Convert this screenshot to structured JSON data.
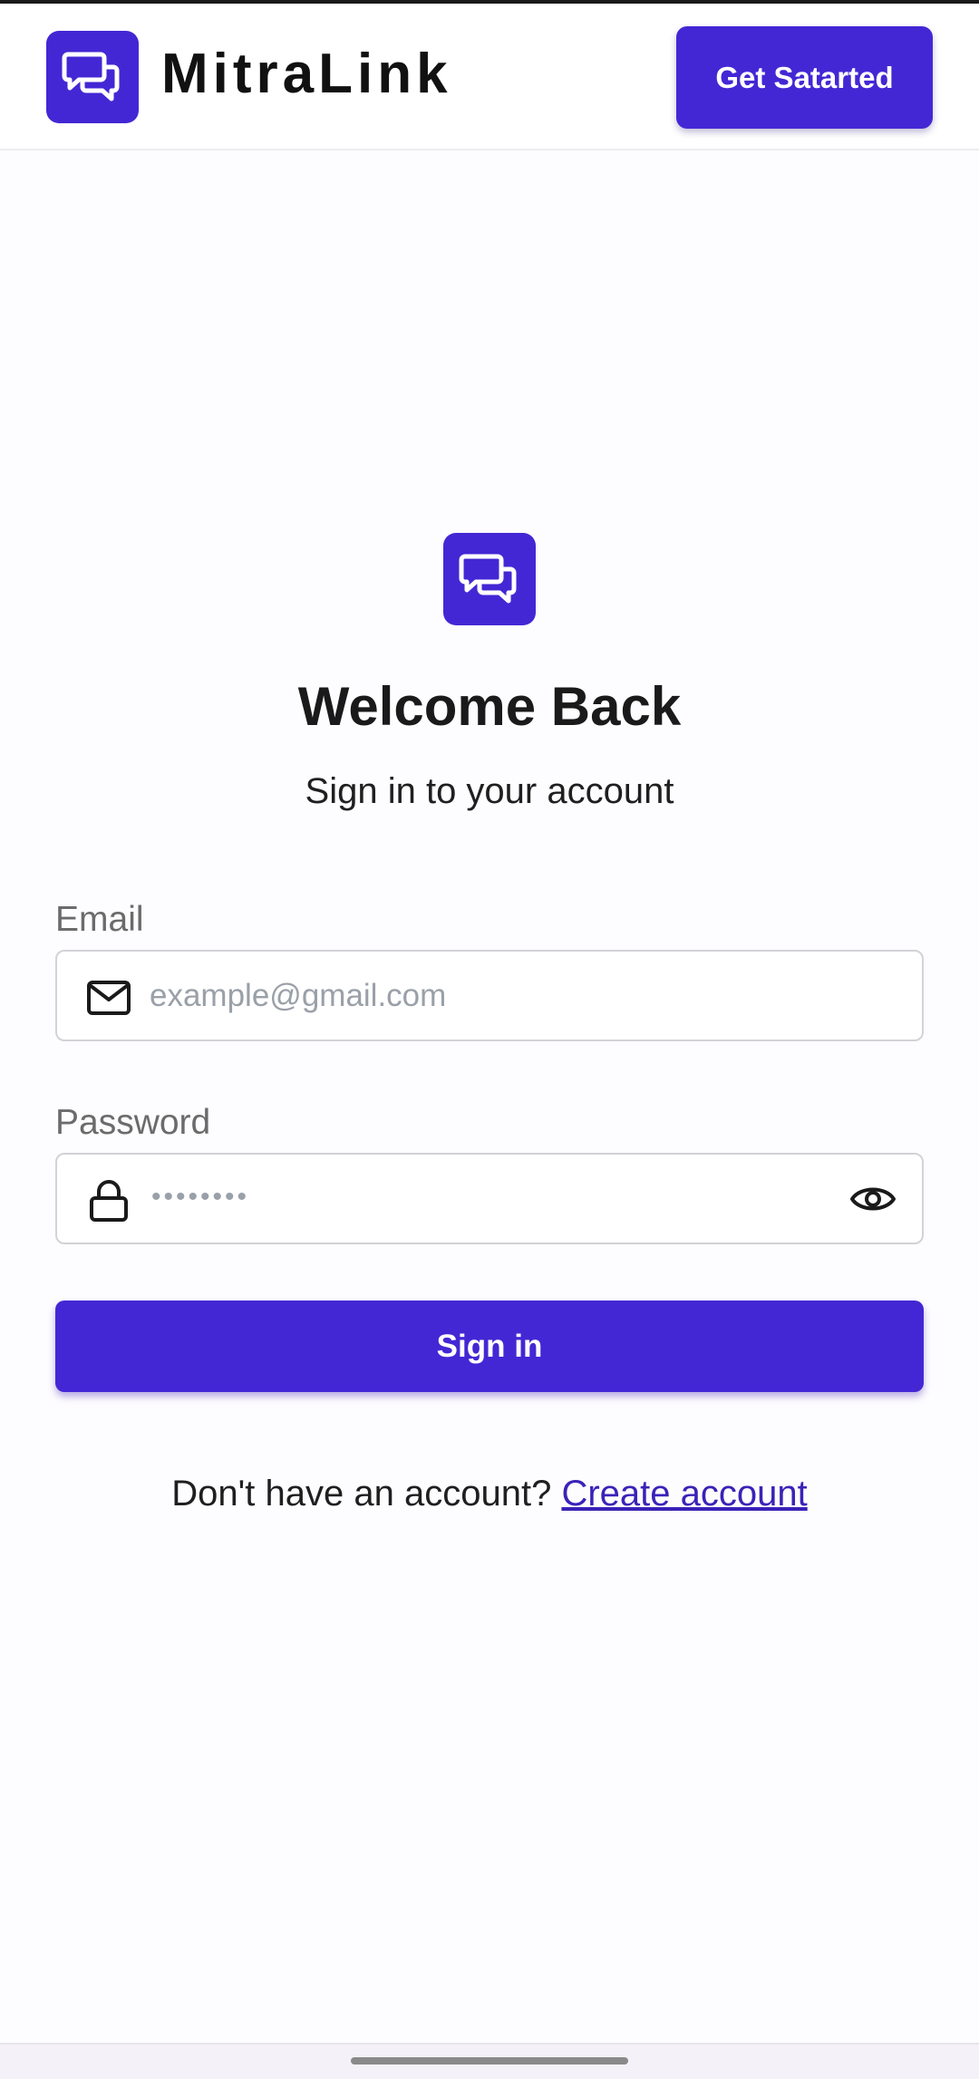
{
  "header": {
    "brand_name": "MitraLink",
    "cta_label": "Get Satarted",
    "logo_icon": "chat-bubbles-icon"
  },
  "hero": {
    "logo_icon": "chat-bubbles-icon",
    "title": "Welcome Back",
    "subtitle": "Sign in to your account"
  },
  "form": {
    "email": {
      "label": "Email",
      "placeholder": "example@gmail.com",
      "value": "",
      "icon": "mail-icon"
    },
    "password": {
      "label": "Password",
      "masked_value": "••••••••",
      "icon": "lock-icon",
      "toggle_icon": "eye-icon"
    },
    "submit_label": "Sign in"
  },
  "footer": {
    "prompt": "Don't have an account?",
    "link_label": "Create account"
  },
  "colors": {
    "accent": "#4427d4",
    "link": "#3a22b8",
    "background": "#fdfcfe"
  }
}
